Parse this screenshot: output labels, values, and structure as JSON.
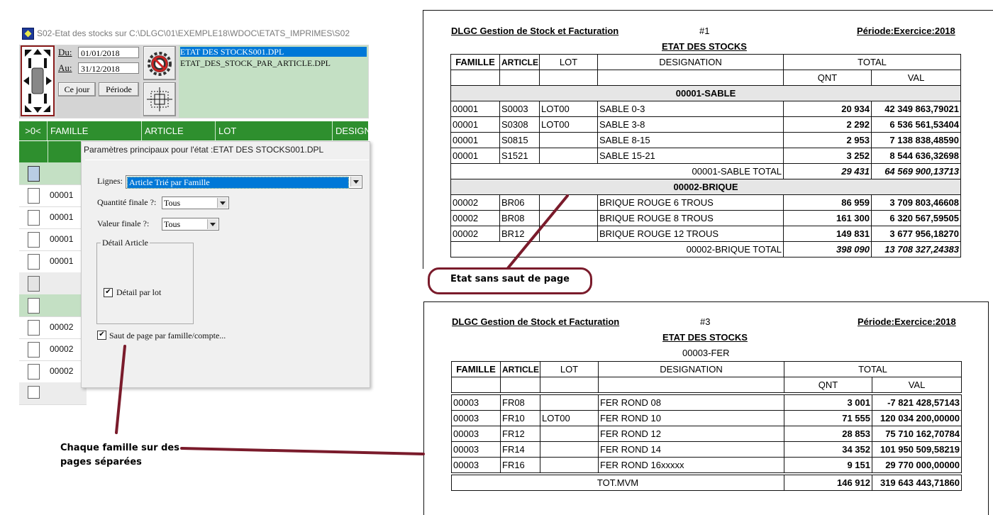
{
  "window": {
    "title": "S02-Etat des stocks sur C:\\DLGC\\01\\EXEMPLE18\\WDOC\\ETATS_IMPRIMES\\S02"
  },
  "period": {
    "du_label": "Du:",
    "du_value": "01/01/2018",
    "au_label": "Au:",
    "au_value": "31/12/2018",
    "ce_jour": "Ce jour",
    "periode": "Période"
  },
  "files": [
    "ETAT DES STOCKS001.DPL",
    "ETAT_DES_STOCK_PAR_ARTICLE.DPL"
  ],
  "grid": {
    "columns": [
      ">0<",
      "FAMILLE",
      "ARTICLE",
      "LOT",
      "DESIGN"
    ],
    "rows": [
      "",
      "00001",
      "00001",
      "00001",
      "00001",
      "",
      "",
      "00002",
      "00002",
      "00002",
      ""
    ]
  },
  "dialog": {
    "title": "Paramètres principaux pour l'état :ETAT DES STOCKS001.DPL",
    "lignes_label": "Lignes:",
    "lignes_value": "Article Trié par Famille",
    "quantite_label": "Quantité finale ?:",
    "quantite_value": "Tous",
    "valeur_label": "Valeur finale ?:",
    "valeur_value": "Tous",
    "group_label": "Détail Article",
    "detail_lot_label": "Détail par lot",
    "saut_label": "Saut de page par famille/compte...",
    "detail_lot_checked": "✔",
    "saut_checked": "✔"
  },
  "report1": {
    "company": "DLGC Gestion de Stock et Facturation",
    "page": "#1",
    "period": "Période:Exercice:2018",
    "title": "ETAT DES STOCKS",
    "headers": [
      "FAMILLE",
      "ARTICLE",
      "LOT",
      "DESIGNATION",
      "TOTAL",
      "QNT",
      "VAL"
    ],
    "group1": "00001-SABLE",
    "rows1": [
      [
        "00001",
        "S0003",
        "LOT00",
        "SABLE 0-3",
        "20 934",
        "42 349 863,79021"
      ],
      [
        "00001",
        "S0308",
        "LOT00",
        "SABLE 3-8",
        "2 292",
        "6 536 561,53404"
      ],
      [
        "00001",
        "S0815",
        "",
        "SABLE 8-15",
        "2 953",
        "7 138 838,48590"
      ],
      [
        "00001",
        "S1521",
        "",
        "SABLE 15-21",
        "3 252",
        "8 544 636,32698"
      ]
    ],
    "total1": [
      "00001-SABLE  TOTAL",
      "29 431",
      "64 569 900,13713"
    ],
    "group2": "00002-BRIQUE",
    "rows2": [
      [
        "00002",
        "BR06",
        "",
        "BRIQUE ROUGE 6 TROUS",
        "86 959",
        "3 709 803,46608"
      ],
      [
        "00002",
        "BR08",
        "",
        "BRIQUE ROUGE 8 TROUS",
        "161 300",
        "6 320 567,59505"
      ],
      [
        "00002",
        "BR12",
        "",
        "BRIQUE ROUGE 12 TROUS",
        "149 831",
        "3 677 956,18270"
      ]
    ],
    "total2": [
      "00002-BRIQUE  TOTAL",
      "398 090",
      "13 708 327,24383"
    ]
  },
  "report2": {
    "company": "DLGC Gestion de Stock et Facturation",
    "page": "#3",
    "period": "Période:Exercice:2018",
    "title": "ETAT DES STOCKS",
    "subtitle": "00003-FER",
    "headers": [
      "FAMILLE",
      "ARTICLE",
      "LOT",
      "DESIGNATION",
      "TOTAL",
      "QNT",
      "VAL"
    ],
    "rows": [
      [
        "00003",
        "FR08",
        "",
        "FER ROND 08",
        "3 001",
        "-7 821 428,57143"
      ],
      [
        "00003",
        "FR10",
        "LOT00",
        "FER ROND 10",
        "71 555",
        "120 034 200,00000"
      ],
      [
        "00003",
        "FR12",
        "",
        "FER ROND 12",
        "28 853",
        "75 710 162,70784"
      ],
      [
        "00003",
        "FR14",
        "",
        "FER ROND 14",
        "34 352",
        "101 950 509,58219"
      ],
      [
        "00003",
        "FR16",
        "",
        "FER ROND 16xxxxx",
        "9 151",
        "29 770 000,00000"
      ]
    ],
    "total": [
      "TOT.MVM",
      "146 912",
      "319 643 443,71860"
    ]
  },
  "annotations": {
    "callout": "Etat sans saut de page",
    "note_line1": "Chaque famille sur des",
    "note_line2": "pages séparées"
  },
  "colors": {
    "grid_green": "#2e8f2e",
    "file_list_bg": "#c4e0c4",
    "selection_blue": "#0078d7",
    "annotation_maroon": "#7a1b2b"
  }
}
